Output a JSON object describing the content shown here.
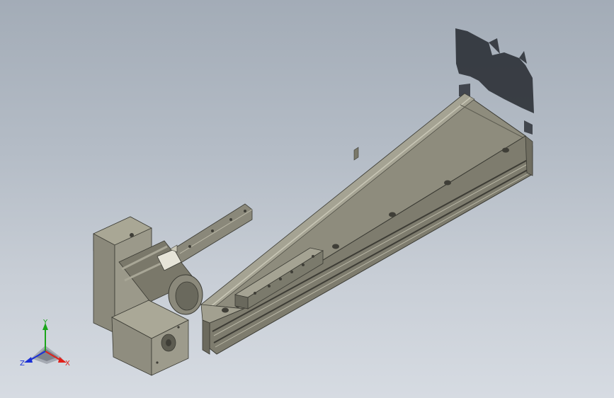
{
  "viewport": {
    "background_top": "#a3acb7",
    "background_bottom": "#d6dbe2",
    "model": {
      "body_color": "#8d8b7c",
      "body_light": "#b9b7a6",
      "body_dark": "#5e5d52",
      "shadow_color": "#2b2f35"
    }
  },
  "triad": {
    "x_label": "X",
    "y_label": "Y",
    "z_label": "Z",
    "x_color": "#e0201a",
    "y_color": "#1aa51a",
    "z_color": "#1a2fd6"
  }
}
